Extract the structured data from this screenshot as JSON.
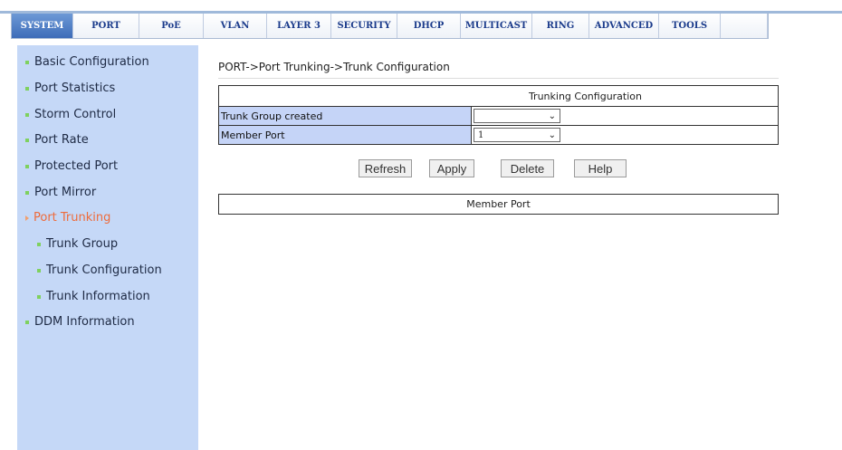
{
  "tabs": [
    {
      "label": "SYSTEM",
      "active": true
    },
    {
      "label": "PORT",
      "active": false
    },
    {
      "label": "PoE",
      "active": false
    },
    {
      "label": "VLAN",
      "active": false
    },
    {
      "label": "LAYER 3",
      "active": false
    },
    {
      "label": "SECURITY",
      "active": false
    },
    {
      "label": "DHCP",
      "active": false
    },
    {
      "label": "MULTICAST",
      "active": false
    },
    {
      "label": "RING",
      "active": false
    },
    {
      "label": "ADVANCED",
      "active": false
    },
    {
      "label": "TOOLS",
      "active": false
    }
  ],
  "sidebar": {
    "items": [
      {
        "label": "Basic Configuration"
      },
      {
        "label": "Port Statistics"
      },
      {
        "label": "Storm Control"
      },
      {
        "label": "Port Rate"
      },
      {
        "label": "Protected Port"
      },
      {
        "label": "Port Mirror"
      },
      {
        "label": "Port Trunking"
      },
      {
        "label": "Trunk Group"
      },
      {
        "label": "Trunk Configuration"
      },
      {
        "label": "Trunk Information"
      },
      {
        "label": "DDM Information"
      }
    ]
  },
  "breadcrumb": "PORT->Port Trunking->Trunk Configuration",
  "config_table": {
    "title": "Trunking Configuration",
    "rows": [
      {
        "label": "Trunk Group created",
        "value": ""
      },
      {
        "label": "Member Port",
        "value": "1"
      }
    ]
  },
  "buttons": {
    "refresh": "Refresh",
    "apply": "Apply",
    "delete": "Delete",
    "help": "Help"
  },
  "member_table": {
    "title": "Member Port"
  },
  "colors": {
    "accent": "#3d6cb8",
    "sidebar_bg": "#c5d8f7",
    "active_item": "#ee6b3b",
    "bullet": "#7fd15f",
    "label_cell": "#c5d4f7"
  },
  "icons": {
    "dropdown": "chevron-down-icon",
    "bullet": "square-bullet-icon",
    "active_marker": "triangle-right-icon"
  }
}
